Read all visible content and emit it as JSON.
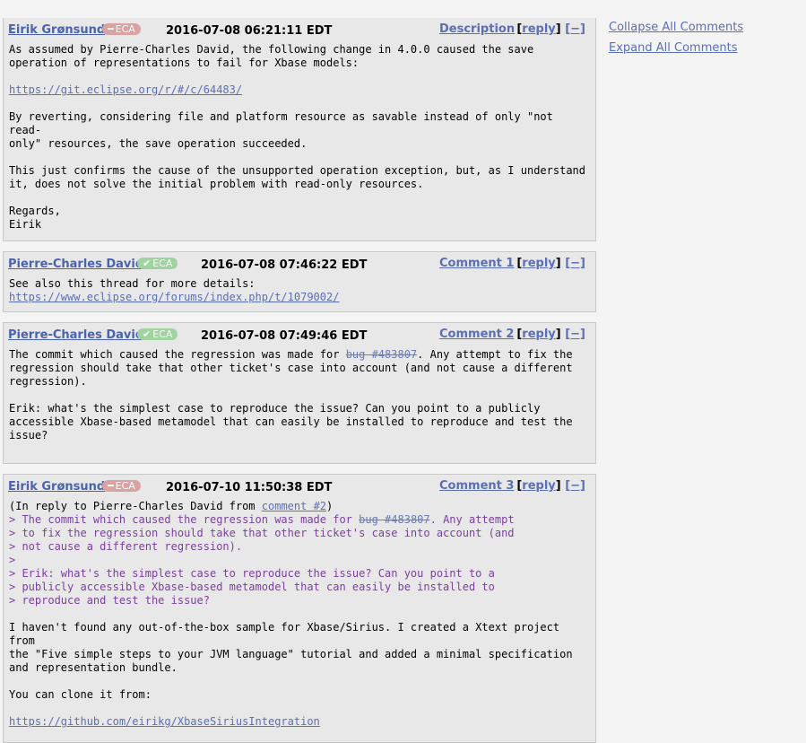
{
  "comments": [
    {
      "author": "Eirik Grønsund",
      "eca_status": "bad",
      "eca": "ECA",
      "datetime": "2016-07-08 06:21:11 EDT",
      "label": "Description",
      "reply": "reply",
      "collapse": "[−]",
      "body": {
        "p1": "As assumed by Pierre-Charles David, the following change in 4.0.0 caused the save\noperation of representations to fail for Xbase models:\n\n",
        "link": "https://git.eclipse.org/r/#/c/64483/",
        "p2": "\n\nBy reverting, considering file and platform resource as savable instead of only \"not read-\nonly\" resources, the save operation succeeded.\n\nThis just confirms the cause of the unsupported operation exception, but, as I understand\nit, does not solve the initial problem with read-only resources.\n\nRegards,\nEirik"
      }
    },
    {
      "author": "Pierre-Charles David",
      "eca_status": "good",
      "eca": "ECA",
      "datetime": "2016-07-08 07:46:22 EDT",
      "label": "Comment 1",
      "reply": "reply",
      "collapse": "[−]",
      "body": {
        "p1": "See also this thread for more details: ",
        "link": "https://www.eclipse.org/forums/index.php/t/1079002/"
      }
    },
    {
      "author": "Pierre-Charles David",
      "eca_status": "good",
      "eca": "ECA",
      "datetime": "2016-07-08 07:49:46 EDT",
      "label": "Comment 2",
      "reply": "reply",
      "collapse": "[−]",
      "body": {
        "p1": "The commit which caused the regression was made for ",
        "bug": "bug #483807",
        "p2": ". Any attempt to fix the\nregression should take that other ticket's case into account (and not cause a different\nregression).\n\nErik: what's the simplest case to reproduce the issue? Can you point to a publicly\naccessible Xbase-based metamodel that can easily be installed to reproduce and test the\nissue?"
      }
    },
    {
      "author": "Eirik Grønsund",
      "eca_status": "bad",
      "eca": "ECA",
      "datetime": "2016-07-10 11:50:38 EDT",
      "label": "Comment 3",
      "reply": "reply",
      "collapse": "[−]",
      "body": {
        "intro": "(In reply to Pierre-Charles David from ",
        "intro_link": "comment #2",
        "intro_end": ")",
        "q1": "> The commit which caused the regression was made for ",
        "bug": "bug #483807",
        "q2": ". Any attempt\n> to fix the regression should take that other ticket's case into account (and\n> not cause a different regression).\n>\n> Erik: what's the simplest case to reproduce the issue? Can you point to a\n> publicly accessible Xbase-based metamodel that can easily be installed to\n> reproduce and test the issue?",
        "p1": "\n\nI haven't found any out-of-the-box sample for Xbase/Sirius. I created a Xtext project from\nthe \"Five simple steps to your JVM language\" tutorial and added a minimal specification\nand representation bundle.\n\nYou can clone it from:\n\n",
        "link": "https://github.com/eirikg/XbaseSiriusIntegration"
      }
    }
  ],
  "sidebar": {
    "collapse_all": "Collapse All Comments",
    "expand_all": "Expand All Comments"
  }
}
